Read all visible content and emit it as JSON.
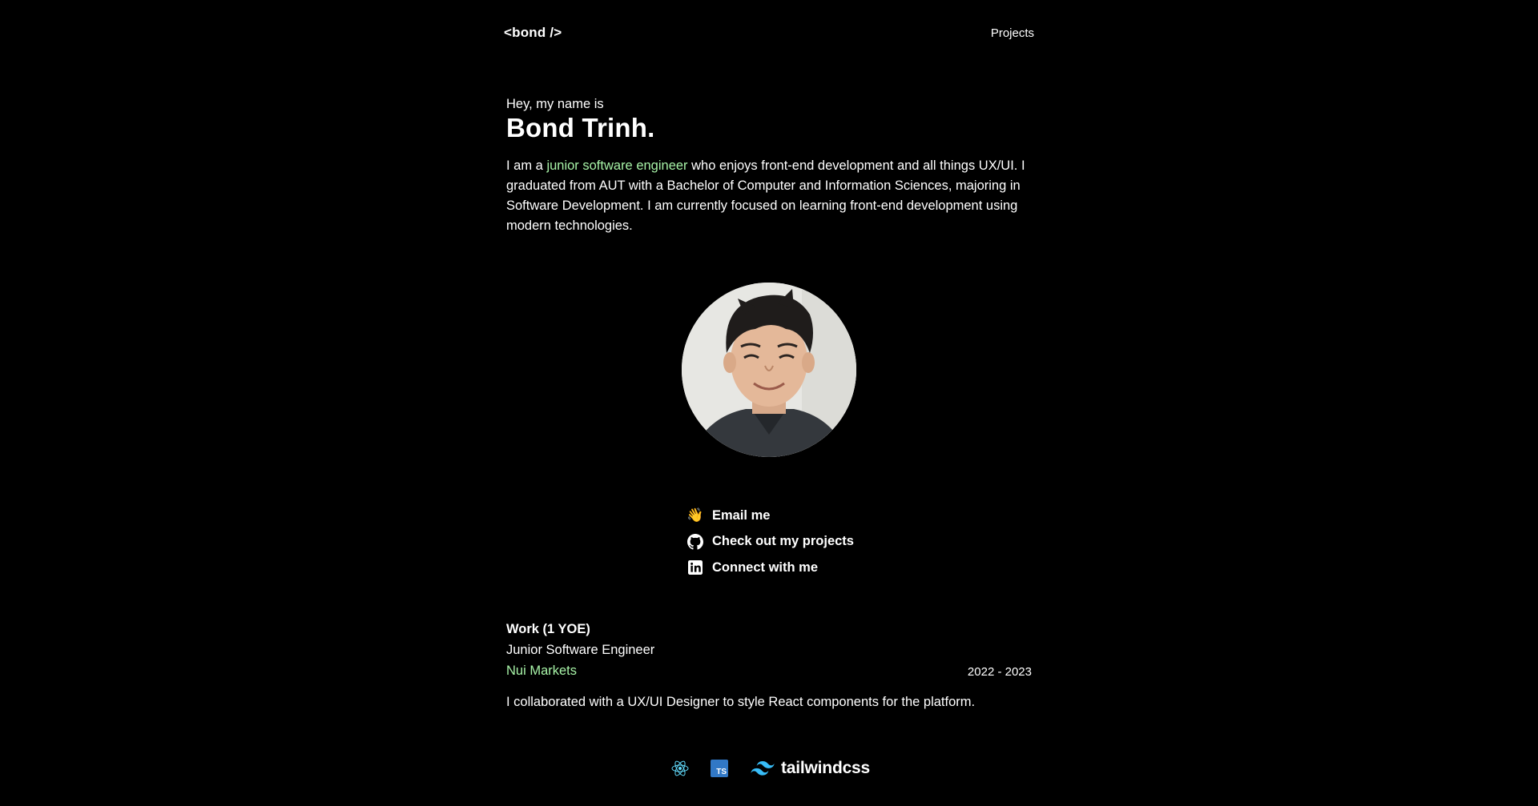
{
  "header": {
    "logo": "<bond />",
    "nav_projects": "Projects"
  },
  "hero": {
    "greeting": "Hey, my name is",
    "name": "Bond Trinh.",
    "bio_prefix": "I am a ",
    "bio_highlight": "junior software engineer",
    "bio_rest": " who enjoys front-end development and all things UX/UI. I graduated from AUT with a Bachelor of Computer and Information Sciences, majoring in Software Development. I am currently focused on learning front-end development using modern technologies."
  },
  "links": [
    {
      "icon": "waving-hand-icon",
      "label": "Email me"
    },
    {
      "icon": "github-icon",
      "label": "Check out my projects"
    },
    {
      "icon": "linkedin-icon",
      "label": "Connect with me"
    }
  ],
  "work": {
    "heading": "Work (1 YOE)",
    "role": "Junior Software Engineer",
    "company": "Nui Markets",
    "dates": "2022 - 2023",
    "description": "I collaborated with a UX/UI Designer to style React components for the platform."
  },
  "tech_stack": {
    "items": [
      "react-icon",
      "typescript-icon",
      "tailwindcss-icon"
    ],
    "typescript_badge": "TS",
    "tailwind_label": "tailwindcss"
  },
  "colors": {
    "background": "#000000",
    "text": "#ffffff",
    "accent": "#a7f3a7",
    "react": "#61dafb",
    "typescript": "#3178c6",
    "tailwind": "#38bdf8"
  }
}
